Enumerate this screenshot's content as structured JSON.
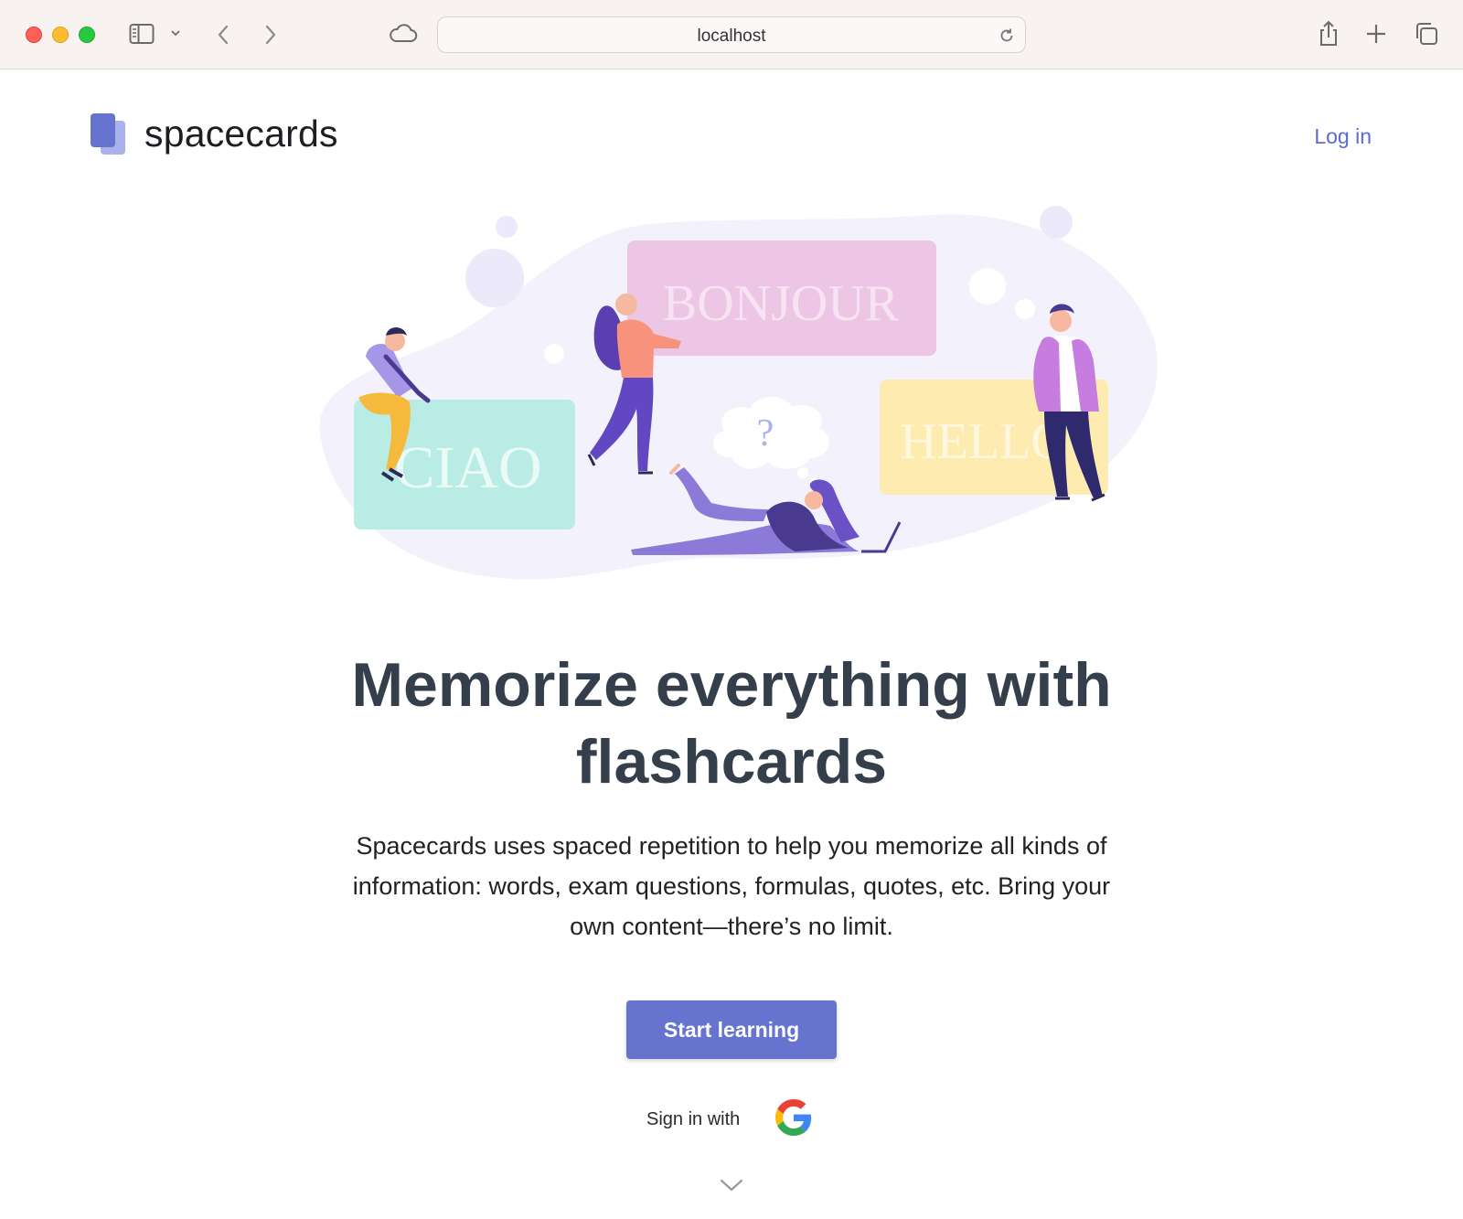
{
  "browser": {
    "url": "localhost",
    "icons": [
      "sidebar-icon",
      "chevron-down-icon",
      "back-icon",
      "forward-icon",
      "icloud-icon",
      "reload-icon",
      "share-icon",
      "new-tab-icon",
      "tab-overview-icon"
    ]
  },
  "header": {
    "brand": "spacecards",
    "login_label": "Log in"
  },
  "hero": {
    "cards": [
      "BONJOUR",
      "CIAO",
      "HELLO",
      "?"
    ]
  },
  "main": {
    "headline_line1": "Memorize everything with",
    "headline_line2": "flashcards",
    "description_line1": "Spacecards uses spaced repetition to help you memorize all kinds of",
    "description_line2": "information: words, exam questions, formulas, quotes, etc. Bring your",
    "description_line3": "own content—there’s no limit.",
    "cta_label": "Start learning",
    "signin_label": "Sign in with"
  },
  "colors": {
    "accent": "#6674cf",
    "link": "#5b6bcf",
    "headline": "#343f4b",
    "card_pink": "#ecc6e4",
    "card_mint": "#b9ece4",
    "card_yellow": "#fdebb0",
    "blob": "#f3f2fc"
  }
}
